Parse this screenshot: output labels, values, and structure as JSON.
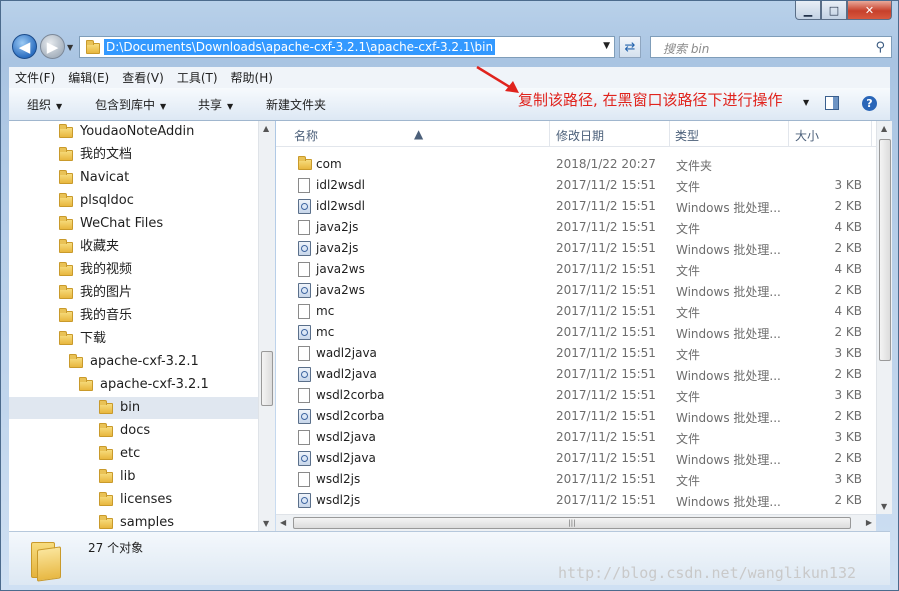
{
  "window": {
    "controls": {
      "minimize": "▁",
      "maximize": "□",
      "close": "✕"
    }
  },
  "address": {
    "path": "D:\\Documents\\Downloads\\apache-cxf-3.2.1\\apache-cxf-3.2.1\\bin",
    "search_placeholder": "搜索 bin"
  },
  "menu": [
    "文件(F)",
    "编辑(E)",
    "查看(V)",
    "工具(T)",
    "帮助(H)"
  ],
  "toolbar": {
    "organize": "组织",
    "include_library": "包含到库中",
    "share": "共享",
    "new_folder": "新建文件夹"
  },
  "annotation": "复制该路径, 在黑窗口该路径下进行操作",
  "nav": [
    {
      "label": "YoudaoNoteAddin",
      "icon": "folder-icon",
      "indent": 0
    },
    {
      "label": "我的文档",
      "icon": "documents-icon",
      "indent": 0
    },
    {
      "label": "Navicat",
      "icon": "folder-icon",
      "indent": 1
    },
    {
      "label": "plsqldoc",
      "icon": "folder-icon",
      "indent": 1
    },
    {
      "label": "WeChat Files",
      "icon": "folder-icon",
      "indent": 1
    },
    {
      "label": "收藏夹",
      "icon": "favorites-icon",
      "indent": 1
    },
    {
      "label": "我的视频",
      "icon": "videos-icon",
      "indent": 1
    },
    {
      "label": "我的图片",
      "icon": "pictures-icon",
      "indent": 1
    },
    {
      "label": "我的音乐",
      "icon": "music-icon",
      "indent": 1
    },
    {
      "label": "下载",
      "icon": "downloads-icon",
      "indent": 1
    },
    {
      "label": "apache-cxf-3.2.1",
      "icon": "folder-icon",
      "indent": 2
    },
    {
      "label": "apache-cxf-3.2.1",
      "icon": "folder-icon",
      "indent": 3
    },
    {
      "label": "bin",
      "icon": "folder-icon",
      "indent": 4,
      "selected": true
    },
    {
      "label": "docs",
      "icon": "folder-icon",
      "indent": 4
    },
    {
      "label": "etc",
      "icon": "folder-icon",
      "indent": 4
    },
    {
      "label": "lib",
      "icon": "folder-icon",
      "indent": 4
    },
    {
      "label": "licenses",
      "icon": "folder-icon",
      "indent": 4
    },
    {
      "label": "samples",
      "icon": "folder-icon",
      "indent": 4
    }
  ],
  "columns": {
    "name": "名称",
    "date": "修改日期",
    "type": "类型",
    "size": "大小"
  },
  "files": [
    {
      "name": "com",
      "date": "2018/1/22 20:27",
      "type": "文件夹",
      "size": "",
      "icon": "folder-icon"
    },
    {
      "name": "idl2wsdl",
      "date": "2017/11/2 15:51",
      "type": "文件",
      "size": "3 KB",
      "icon": "file-icon"
    },
    {
      "name": "idl2wsdl",
      "date": "2017/11/2 15:51",
      "type": "Windows 批处理...",
      "size": "2 KB",
      "icon": "batch-file-icon"
    },
    {
      "name": "java2js",
      "date": "2017/11/2 15:51",
      "type": "文件",
      "size": "4 KB",
      "icon": "file-icon"
    },
    {
      "name": "java2js",
      "date": "2017/11/2 15:51",
      "type": "Windows 批处理...",
      "size": "2 KB",
      "icon": "batch-file-icon"
    },
    {
      "name": "java2ws",
      "date": "2017/11/2 15:51",
      "type": "文件",
      "size": "4 KB",
      "icon": "file-icon"
    },
    {
      "name": "java2ws",
      "date": "2017/11/2 15:51",
      "type": "Windows 批处理...",
      "size": "2 KB",
      "icon": "batch-file-icon"
    },
    {
      "name": "mc",
      "date": "2017/11/2 15:51",
      "type": "文件",
      "size": "4 KB",
      "icon": "file-icon"
    },
    {
      "name": "mc",
      "date": "2017/11/2 15:51",
      "type": "Windows 批处理...",
      "size": "2 KB",
      "icon": "batch-file-icon"
    },
    {
      "name": "wadl2java",
      "date": "2017/11/2 15:51",
      "type": "文件",
      "size": "3 KB",
      "icon": "file-icon"
    },
    {
      "name": "wadl2java",
      "date": "2017/11/2 15:51",
      "type": "Windows 批处理...",
      "size": "2 KB",
      "icon": "batch-file-icon"
    },
    {
      "name": "wsdl2corba",
      "date": "2017/11/2 15:51",
      "type": "文件",
      "size": "3 KB",
      "icon": "file-icon"
    },
    {
      "name": "wsdl2corba",
      "date": "2017/11/2 15:51",
      "type": "Windows 批处理...",
      "size": "2 KB",
      "icon": "batch-file-icon"
    },
    {
      "name": "wsdl2java",
      "date": "2017/11/2 15:51",
      "type": "文件",
      "size": "3 KB",
      "icon": "file-icon"
    },
    {
      "name": "wsdl2java",
      "date": "2017/11/2 15:51",
      "type": "Windows 批处理...",
      "size": "2 KB",
      "icon": "batch-file-icon"
    },
    {
      "name": "wsdl2js",
      "date": "2017/11/2 15:51",
      "type": "文件",
      "size": "3 KB",
      "icon": "file-icon"
    },
    {
      "name": "wsdl2js",
      "date": "2017/11/2 15:51",
      "type": "Windows 批处理...",
      "size": "2 KB",
      "icon": "batch-file-icon"
    }
  ],
  "status": {
    "count": "27 个对象"
  },
  "watermark": "http://blog.csdn.net/wanglikun132",
  "colors": {
    "annotation": "#e0231d",
    "selection": "#3399ff"
  }
}
